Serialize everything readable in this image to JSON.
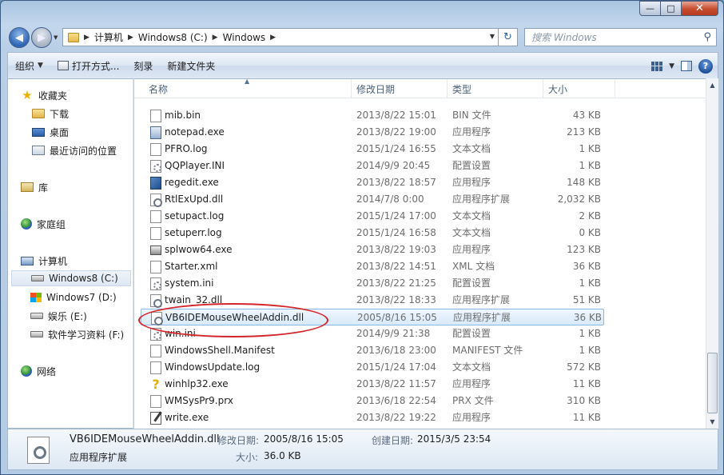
{
  "window": {
    "caption_min": "—",
    "caption_max": "□",
    "caption_close": "✕"
  },
  "address": {
    "crumbs": [
      "计算机",
      "Windows8 (C:)",
      "Windows"
    ],
    "search_placeholder": "搜索 Windows"
  },
  "toolbar": {
    "organize": "组织",
    "open_with": "打开方式...",
    "burn": "刻录",
    "new_folder": "新建文件夹"
  },
  "nav": {
    "favorites": "收藏夹",
    "downloads": "下载",
    "desktop": "桌面",
    "recent": "最近访问的位置",
    "libraries": "库",
    "homegroup": "家庭组",
    "computer": "计算机",
    "drive_c": "Windows8 (C:)",
    "drive_d": "Windows7 (D:)",
    "drive_e": "娱乐 (E:)",
    "drive_f": "软件学习资料 (F:)",
    "network": "网络"
  },
  "columns": {
    "name": "名称",
    "date": "修改日期",
    "type": "类型",
    "size": "大小"
  },
  "files": [
    {
      "name": "mib.bin",
      "date": "2013/8/22 15:01",
      "type": "BIN 文件",
      "size": "43 KB",
      "icon": "doc"
    },
    {
      "name": "notepad.exe",
      "date": "2013/8/22 19:00",
      "type": "应用程序",
      "size": "213 KB",
      "icon": "exe"
    },
    {
      "name": "PFRO.log",
      "date": "2015/1/24 16:55",
      "type": "文本文档",
      "size": "1 KB",
      "icon": "doc"
    },
    {
      "name": "QQPlayer.INI",
      "date": "2014/9/9 20:45",
      "type": "配置设置",
      "size": "1 KB",
      "icon": "ini"
    },
    {
      "name": "regedit.exe",
      "date": "2013/8/22 18:57",
      "type": "应用程序",
      "size": "148 KB",
      "icon": "reg"
    },
    {
      "name": "RtlExUpd.dll",
      "date": "2014/7/8 0:00",
      "type": "应用程序扩展",
      "size": "2,032 KB",
      "icon": "dll"
    },
    {
      "name": "setupact.log",
      "date": "2015/1/24 17:00",
      "type": "文本文档",
      "size": "2 KB",
      "icon": "doc"
    },
    {
      "name": "setuperr.log",
      "date": "2015/1/24 16:58",
      "type": "文本文档",
      "size": "0 KB",
      "icon": "doc"
    },
    {
      "name": "splwow64.exe",
      "date": "2013/8/22 19:03",
      "type": "应用程序",
      "size": "123 KB",
      "icon": "print"
    },
    {
      "name": "Starter.xml",
      "date": "2013/8/22 14:51",
      "type": "XML 文档",
      "size": "36 KB",
      "icon": "xml"
    },
    {
      "name": "system.ini",
      "date": "2013/8/22 21:25",
      "type": "配置设置",
      "size": "1 KB",
      "icon": "ini"
    },
    {
      "name": "twain_32.dll",
      "date": "2013/8/22 18:33",
      "type": "应用程序扩展",
      "size": "51 KB",
      "icon": "dll"
    },
    {
      "name": "VB6IDEMouseWheelAddin.dll",
      "date": "2005/8/16 15:05",
      "type": "应用程序扩展",
      "size": "36 KB",
      "icon": "dll",
      "selected": true
    },
    {
      "name": "win.ini",
      "date": "2014/9/9 21:38",
      "type": "配置设置",
      "size": "1 KB",
      "icon": "ini"
    },
    {
      "name": "WindowsShell.Manifest",
      "date": "2013/6/18 23:00",
      "type": "MANIFEST 文件",
      "size": "1 KB",
      "icon": "doc"
    },
    {
      "name": "WindowsUpdate.log",
      "date": "2015/1/24 17:04",
      "type": "文本文档",
      "size": "572 KB",
      "icon": "doc"
    },
    {
      "name": "winhlp32.exe",
      "date": "2013/8/22 11:57",
      "type": "应用程序",
      "size": "11 KB",
      "icon": "help"
    },
    {
      "name": "WMSysPr9.prx",
      "date": "2013/6/18 22:54",
      "type": "PRX 文件",
      "size": "310 KB",
      "icon": "doc"
    },
    {
      "name": "write.exe",
      "date": "2013/8/22 19:22",
      "type": "应用程序",
      "size": "11 KB",
      "icon": "write"
    }
  ],
  "details": {
    "filename": "VB6IDEMouseWheelAddin.dll",
    "filetype": "应用程序扩展",
    "modified_label": "修改日期:",
    "modified_value": "2005/8/16 15:05",
    "created_label": "创建日期:",
    "created_value": "2015/3/5 23:54",
    "size_label": "大小:",
    "size_value": "36.0 KB"
  },
  "colors": {
    "annotation": "#d3262a",
    "selection": "#d8eafc"
  }
}
